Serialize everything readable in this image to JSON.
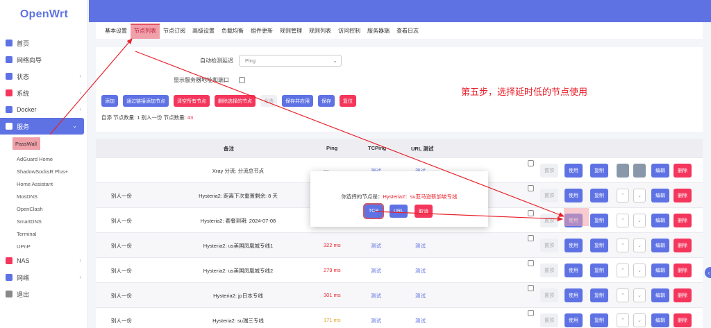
{
  "app": {
    "logo": "OpenWrt"
  },
  "colors": {
    "accent": "#5e72e4",
    "danger": "#f5365c",
    "annotation": "#e8202a",
    "highlight": "#f0a0a8"
  },
  "sidebar": {
    "items": [
      {
        "label": "首页",
        "icon": "home-icon",
        "chev": ""
      },
      {
        "label": "网络向导",
        "icon": "wand-icon",
        "chev": ""
      },
      {
        "label": "状态",
        "icon": "grid-icon",
        "chev": "›"
      },
      {
        "label": "系统",
        "icon": "gear-icon",
        "chev": "›"
      },
      {
        "label": "Docker",
        "icon": "docker-icon",
        "chev": "›"
      },
      {
        "label": "服务",
        "icon": "link-icon",
        "chev": "⌄"
      }
    ],
    "services": [
      "PassWall",
      "AdGuard Home",
      "ShadowSocksR Plus+",
      "Home Assistant",
      "MosDNS",
      "OpenClash",
      "SmartDNS",
      "Terminal",
      "UPnP"
    ],
    "bottom": [
      {
        "label": "NAS",
        "icon": "nas-icon",
        "chev": "›"
      },
      {
        "label": "网络",
        "icon": "network-icon",
        "chev": "›"
      },
      {
        "label": "退出",
        "icon": "logout-icon",
        "chev": ""
      }
    ]
  },
  "tabs": [
    "基本设置",
    "节点列表",
    "节点订阅",
    "高级设置",
    "负载均衡",
    "组件更新",
    "规则管理",
    "规则列表",
    "访问控制",
    "服务器端",
    "查看日志"
  ],
  "form": {
    "latency_label": "自动检测延迟",
    "latency_value": "Ping",
    "show_addr_label": "显示服务器地址和端口"
  },
  "actions": {
    "add": "添加",
    "add_by_link": "通过链接添加节点",
    "clear_all": "清空所有节点",
    "delete_selected": "删除选择的节点",
    "select_all": "全选",
    "save_apply": "保存并应用",
    "save": "保存",
    "reset": "复位"
  },
  "counts": {
    "text": "自添 节点数量: 1   别人一份 节点数量:",
    "count": "43"
  },
  "annotation": "第五步，选择延时低的节点使用",
  "table": {
    "headers": {
      "remark": "备注",
      "ping": "Ping",
      "tcping": "TCPing",
      "url": "URL 测试"
    },
    "rows": [
      {
        "group": "",
        "remark": "Xray 分流: 分流总节点",
        "ping": "---",
        "ping_color": "#666666",
        "tcp": "测试",
        "url": "测试"
      },
      {
        "group": "别人一份",
        "remark": "Hysteria2: 距离下次重置剩余: 8 天",
        "ping": "",
        "ping_color": "#666666",
        "tcp": "",
        "url": ""
      },
      {
        "group": "别人一份",
        "remark": "Hysteria2: 套餐到期: 2024-07-08",
        "ping": "",
        "ping_color": "#666666",
        "tcp": "",
        "url": ""
      },
      {
        "group": "别人一份",
        "remark": "Hysteria2: us美国凤凰城专线1",
        "ping": "322 ms",
        "ping_color": "#e8202a",
        "tcp": "测试",
        "url": "测试"
      },
      {
        "group": "别人一份",
        "remark": "Hysteria2: us美国凤凰城专线2",
        "ping": "279 ms",
        "ping_color": "#e8202a",
        "tcp": "测试",
        "url": "测试"
      },
      {
        "group": "别人一份",
        "remark": "Hysteria2: jp日本专线",
        "ping": "301 ms",
        "ping_color": "#e8202a",
        "tcp": "测试",
        "url": "测试"
      },
      {
        "group": "别人一份",
        "remark": "Hysteria2: su瑞三专线",
        "ping": "171 ms",
        "ping_color": "#e0a020",
        "tcp": "测试",
        "url": "测试"
      }
    ],
    "btn": {
      "top": "置顶",
      "use": "使用",
      "copy": "复制",
      "edit": "编辑",
      "del": "删除",
      "up": "⌃",
      "down": "⌄"
    }
  },
  "modal": {
    "msg_prefix": "你选择的节点是：",
    "node": "Hysteria2：su亚马逊新加坡专线",
    "tcp": "TCP",
    "url": "URL",
    "cancel": "取消"
  }
}
